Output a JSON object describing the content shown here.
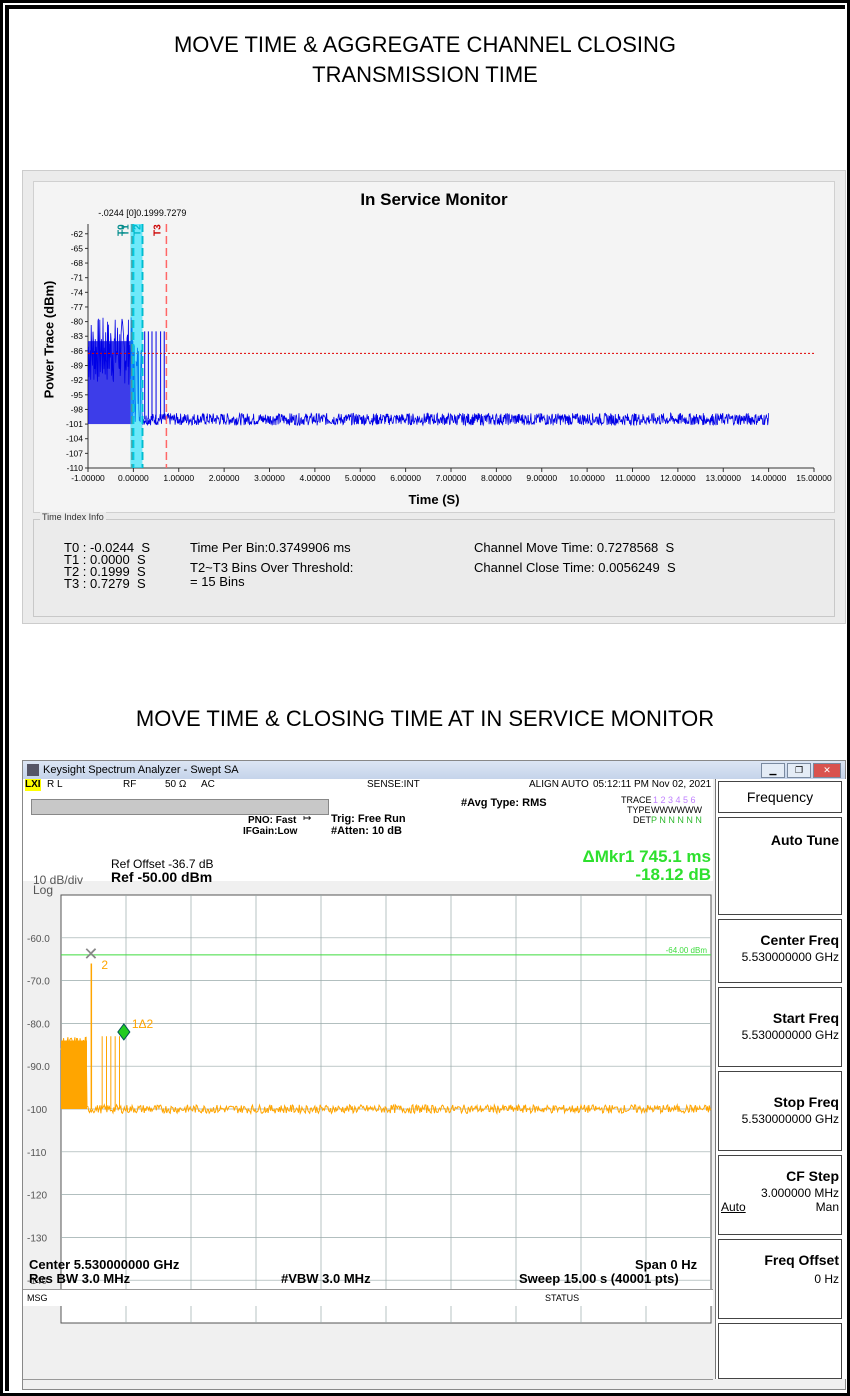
{
  "titles": {
    "top": "MOVE TIME & AGGREGATE CHANNEL CLOSING\nTRANSMISSION TIME",
    "bottom": "MOVE TIME & CLOSING TIME AT IN SERVICE MONITOR"
  },
  "ism": {
    "title": "In Service Monitor",
    "ylabel": "Power Trace (dBm)",
    "xlabel": "Time (S)",
    "marker_header": "-.0244  [0]0.1999.7279",
    "marker_labels": [
      "T0",
      "T1",
      "T2",
      "T3"
    ],
    "info_legend": "Time Index Info",
    "t_values": [
      "T0 : -0.0244  S",
      "T1 : 0.0000  S",
      "T2 : 0.1999  S",
      "T3 : 0.7279  S"
    ],
    "time_per_bin": "Time Per Bin:0.3749906 ms",
    "bins_over": "T2~T3 Bins Over Threshold:",
    "bins_count": "= 15 Bins",
    "move_time": "Channel Move Time: 0.7278568  S",
    "close_time": "Channel Close Time: 0.0056249  S"
  },
  "chart_data": [
    {
      "type": "line",
      "title": "In Service Monitor",
      "xlabel": "Time (S)",
      "ylabel": "Power Trace (dBm)",
      "xlim": [
        -1,
        15
      ],
      "ylim": [
        -110,
        -60
      ],
      "x_ticks": [
        "-1.00000",
        "0.00000",
        "1.00000",
        "2.00000",
        "3.00000",
        "4.00000",
        "5.00000",
        "6.00000",
        "7.00000",
        "8.00000",
        "9.00000",
        "10.00000",
        "11.00000",
        "12.00000",
        "13.00000",
        "14.00000",
        "15.00000"
      ],
      "y_ticks": [
        "-62",
        "-65",
        "-68",
        "-71",
        "-74",
        "-77",
        "-80",
        "-83",
        "-86",
        "-89",
        "-92",
        "-95",
        "-98",
        "-101",
        "-104",
        "-107",
        "-110"
      ],
      "threshold": -86.5,
      "markers": [
        -0.0244,
        0.0,
        0.1999,
        0.7279
      ],
      "series": [
        {
          "x": [
            -1.0,
            -0.1,
            0.0,
            0.2,
            0.73,
            1.0,
            14.0
          ],
          "values": [
            -86,
            -86,
            -84,
            -100,
            -100,
            -100,
            -100
          ]
        }
      ]
    },
    {
      "type": "line",
      "xlim": [
        0,
        15
      ],
      "ylim": [
        -150,
        -50
      ],
      "y_ticks": [
        "-60.0",
        "-70.0",
        "-80.0",
        "-90.0",
        "-100",
        "-110",
        "-120",
        "-130",
        "-140"
      ],
      "display_line": -64.0,
      "series": [
        {
          "x": [
            0,
            0.1,
            0.6,
            0.7,
            1.0,
            15.0
          ],
          "values": [
            -84,
            -84,
            -66,
            -100,
            -100,
            -100
          ]
        }
      ]
    }
  ],
  "sa": {
    "window_title": "Keysight Spectrum Analyzer - Swept SA",
    "status": {
      "rl": "R L",
      "rf": "RF",
      "ohm": "50 Ω",
      "ac": "AC",
      "sense": "SENSE:INT",
      "align": "ALIGN AUTO",
      "time": "05:12:11 PM Nov 02, 2021"
    },
    "avg_type": "#Avg Type: RMS",
    "trace_label": "TRACE",
    "trace_nums": "1 2 3 4 5 6",
    "type_label": "TYPE",
    "type_val": "WWWWWW",
    "det_label": "DET",
    "det_val": "P N N N N N",
    "pno": "PNO: Fast",
    "ifgain": "IFGain:Low",
    "trig": "Trig: Free Run",
    "atten": "#Atten: 10 dB",
    "ref_offset": "Ref Offset -36.7 dB",
    "ref": "Ref -50.00 dBm",
    "scale": "10 dB/div",
    "log": "Log",
    "mkr": "ΔMkr1 745.1 ms",
    "mkr_db": "-18.12 dB",
    "dl_label": "-64.00 dBm",
    "mkr2": "2",
    "mkr1": "1Δ2",
    "center": "Center 5.530000000 GHz",
    "span": "Span 0 Hz",
    "rbw": "Res BW 3.0 MHz",
    "vbw": "#VBW 3.0 MHz",
    "sweep": "Sweep  15.00 s (40001 pts)",
    "msg": "MSG",
    "status_label": "STATUS",
    "softkeys": {
      "menu": "Frequency",
      "auto_tune": "Auto Tune",
      "center_freq": "Center Freq",
      "center_val": "5.530000000 GHz",
      "start_freq": "Start Freq",
      "start_val": "5.530000000 GHz",
      "stop_freq": "Stop Freq",
      "stop_val": "5.530000000 GHz",
      "cf_step": "CF Step",
      "cf_val": "3.000000 MHz",
      "auto": "Auto",
      "man": "Man",
      "freq_offset": "Freq Offset",
      "offset_val": "0 Hz"
    }
  }
}
